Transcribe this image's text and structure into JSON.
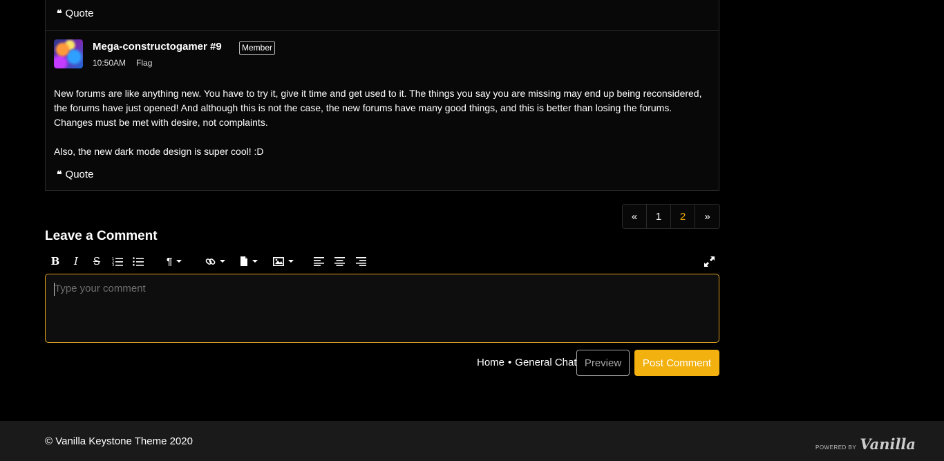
{
  "previous_comment": {
    "quote_label": "Quote"
  },
  "comment": {
    "author": "Mega-constructogamer #9",
    "role": "Member",
    "time": "10:50AM",
    "flag_label": "Flag",
    "paragraphs": [
      "New forums are like anything new. You have to try it, give it time and get used to it. The things you say you are missing may end up being reconsidered, the forums have just opened! And although this is not the case, the new forums have many good things, and this is better than losing the forums. Changes must be met with desire, not complaints.",
      "Also, the new dark mode design is super cool! :D"
    ],
    "quote_label": "Quote"
  },
  "pagination": {
    "prev": "«",
    "pages": [
      "1",
      "2"
    ],
    "current": "2",
    "next": "»"
  },
  "leave_comment": {
    "title": "Leave a Comment",
    "placeholder": "Type your comment"
  },
  "toolbar": {
    "icons": [
      "bold-icon",
      "italic-icon",
      "strikethrough-icon",
      "ordered-list-icon",
      "bullet-list-icon",
      "paragraph-format-icon",
      "link-icon",
      "file-icon",
      "image-icon",
      "align-left-icon",
      "align-center-icon",
      "align-right-icon",
      "fullscreen-icon"
    ]
  },
  "breadcrumb": {
    "home": "Home",
    "separator": "•",
    "category": "General Chat"
  },
  "buttons": {
    "preview": "Preview",
    "post": "Post Comment"
  },
  "footer": {
    "copyright": "© Vanilla Keystone Theme 2020",
    "powered_by": "POWERED BY",
    "brand": "Vanilla"
  },
  "colors": {
    "accent": "#f2b10f",
    "current_page": "#f2a900",
    "background": "#000000",
    "card": "#080808",
    "footer": "#1a1a1a"
  }
}
